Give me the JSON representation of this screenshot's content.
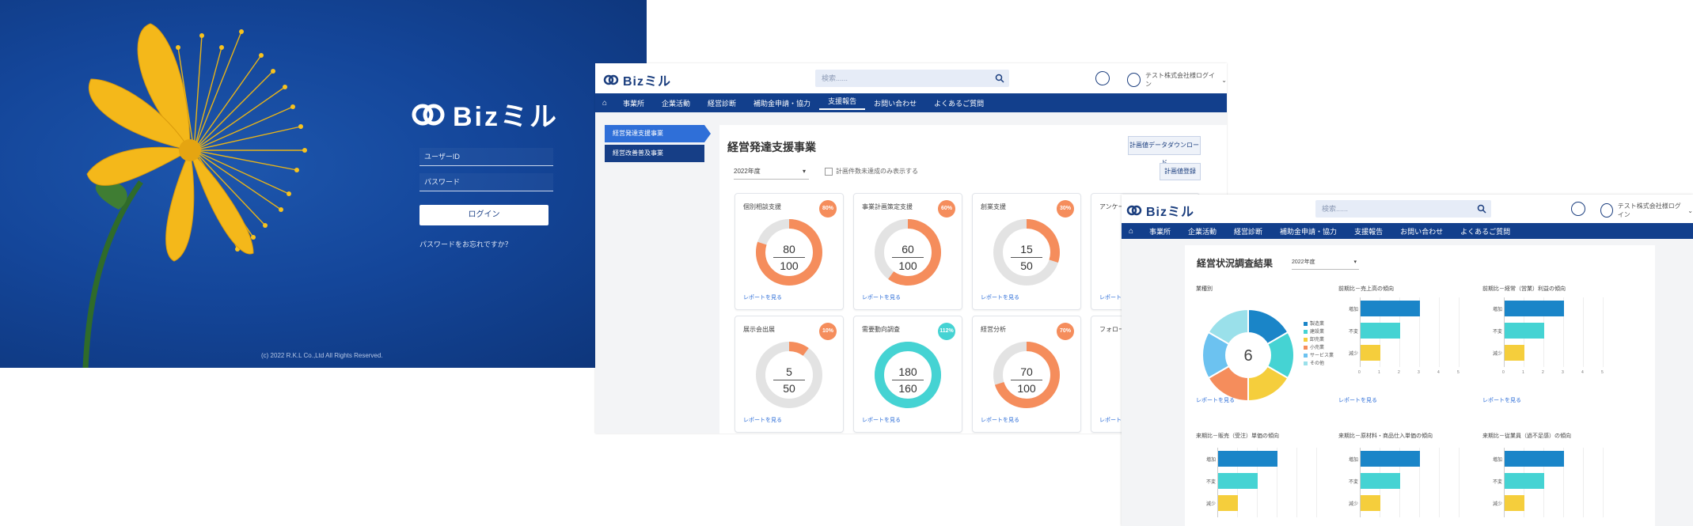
{
  "login": {
    "logo_text": "Bizミル",
    "username_placeholder": "ユーザーID",
    "password_placeholder": "パスワード",
    "login_button": "ログイン",
    "forgot_link": "パスワードをお忘れですか？",
    "copyright": "(c) 2022 R.K.L Co.,Ltd All Rights Reserved."
  },
  "dash1": {
    "logo_text": "Bizミル",
    "search_placeholder": "検索......",
    "user_label": "テスト株式会社様ログイン",
    "nav": [
      "事業所",
      "企業活動",
      "経営診断",
      "補助金申請・協力",
      "支援報告",
      "お問い合わせ",
      "よくあるご質問"
    ],
    "side": [
      "経営発達支援事業",
      "経営改善普及事業"
    ],
    "title": "経営発達支援事業",
    "export_button": "計画値データダウンロード",
    "year": "2022年度",
    "checkbox_label": "計画件数未達成のみ表示する",
    "update_button": "計画値登録",
    "cards": [
      {
        "title": "個別相談支援",
        "badge": "80%",
        "value": "80",
        "target": "100",
        "pct": 0.8,
        "color": "#f58d5c",
        "link": "レポートを見る"
      },
      {
        "title": "事業計画策定支援",
        "badge": "60%",
        "value": "60",
        "target": "100",
        "pct": 0.6,
        "color": "#f58d5c",
        "link": "レポートを見る"
      },
      {
        "title": "創業支援",
        "badge": "30%",
        "value": "15",
        "target": "50",
        "pct": 0.3,
        "color": "#f58d5c",
        "link": "レポートを見る"
      },
      {
        "title": "展示会出展",
        "badge": "10%",
        "value": "5",
        "target": "50",
        "pct": 0.1,
        "color": "#f58d5c",
        "link": "レポートを見る"
      },
      {
        "title": "需要動向調査",
        "badge": "112%",
        "value": "180",
        "target": "160",
        "pct": 1.0,
        "color": "#45d3d3",
        "link": "レポートを見る"
      },
      {
        "title": "経営分析",
        "badge": "70%",
        "value": "70",
        "target": "100",
        "pct": 0.7,
        "color": "#f58d5c",
        "link": "レポートを見る"
      }
    ],
    "partial_titles": [
      "アンケート",
      "フォロー"
    ],
    "partial_link": "レポートを見る"
  },
  "dash2": {
    "logo_text": "Bizミル",
    "search_placeholder": "検索......",
    "user_label": "テスト株式会社様ログイン",
    "nav": [
      "事業所",
      "企業活動",
      "経営診断",
      "補助金申請・協力",
      "支援報告",
      "お問い合わせ",
      "よくあるご質問"
    ],
    "title": "経営状況調査結果",
    "year": "2022年度",
    "sections": {
      "industry": "業種別",
      "sales": "前期比－売上高の傾向",
      "profit": "前期比－経常（営業）利益の傾向",
      "sales2": "来期比－販売（受注）単価の傾向",
      "cost": "来期比－原材料・商品仕入単価の傾向",
      "staff": "来期比－従業員（過不足感）の傾向"
    },
    "donut_center": "6",
    "legend": [
      "製造業",
      "建設業",
      "卸売業",
      "小売業",
      "サービス業",
      "その他"
    ],
    "report_link": "レポートを見る",
    "bar_categories": [
      "増加",
      "不変",
      "減少"
    ],
    "axis_ticks": [
      "0",
      "1",
      "2",
      "3",
      "4",
      "5"
    ]
  },
  "chart_data": [
    {
      "type": "pie",
      "title": "業種別",
      "center_label": "6",
      "categories": [
        "製造業",
        "建設業",
        "卸売業",
        "小売業",
        "サービス業",
        "その他"
      ],
      "values": [
        1,
        1,
        1,
        1,
        1,
        1
      ],
      "colors": [
        "#1a85c8",
        "#45d3d3",
        "#f5ce3c",
        "#f58d5c",
        "#6cc2f0",
        "#9ae0ea"
      ]
    },
    {
      "type": "bar",
      "title": "前期比－売上高の傾向",
      "categories": [
        "増加",
        "不変",
        "減少"
      ],
      "values": [
        3,
        2,
        1
      ],
      "xlim": [
        0,
        5
      ]
    },
    {
      "type": "bar",
      "title": "前期比－経常（営業）利益の傾向",
      "categories": [
        "増加",
        "不変",
        "減少"
      ],
      "values": [
        3,
        2,
        1
      ],
      "xlim": [
        0,
        5
      ]
    },
    {
      "type": "bar",
      "title": "来期比－販売（受注）単価の傾向",
      "categories": [
        "増加",
        "不変",
        "減少"
      ],
      "values": [
        3,
        2,
        1
      ],
      "xlim": [
        0,
        5
      ]
    },
    {
      "type": "bar",
      "title": "来期比－原材料・商品仕入単価の傾向",
      "categories": [
        "増加",
        "不変",
        "減少"
      ],
      "values": [
        3,
        2,
        1
      ],
      "xlim": [
        0,
        5
      ]
    },
    {
      "type": "bar",
      "title": "来期比－従業員（過不足感）の傾向",
      "categories": [
        "増加",
        "不変",
        "減少"
      ],
      "values": [
        3,
        2,
        1
      ],
      "xlim": [
        0,
        5
      ]
    }
  ]
}
